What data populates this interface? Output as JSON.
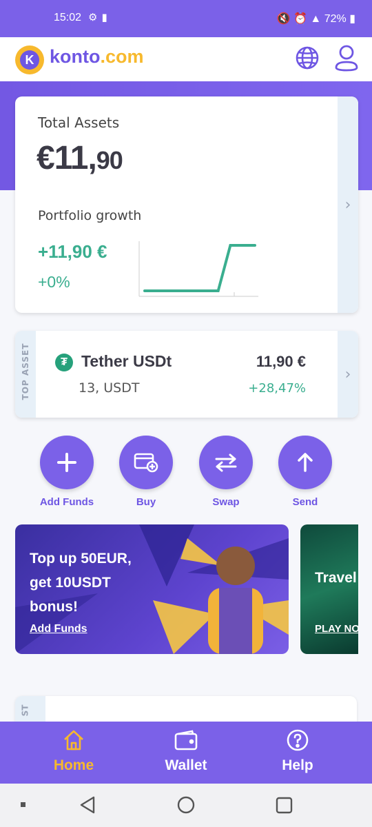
{
  "status_bar": {
    "time": "15:02",
    "battery": "72%"
  },
  "app": {
    "logo_letter": "K",
    "logo_name": "konto",
    "logo_tld": ".com"
  },
  "summary": {
    "total_assets_label": "Total Assets",
    "total_assets_main": "€11,",
    "total_assets_cents": "90",
    "portfolio_growth_label": "Portfolio growth",
    "growth_value": "+11,90 €",
    "growth_percent": "+0%"
  },
  "sparkline": {
    "values": [
      0,
      0,
      0,
      0,
      0,
      0,
      0,
      11.9,
      11.9,
      11.9
    ],
    "color": "#3aae8f"
  },
  "top_asset": {
    "side_label": "TOP ASSET",
    "icon_letter": "₮",
    "name": "Tether USDt",
    "amount": "13, USDT",
    "value": "11,90 €",
    "change": "+28,47%"
  },
  "actions": [
    {
      "label": "Add Funds",
      "icon": "plus-icon"
    },
    {
      "label": "Buy",
      "icon": "card-plus-icon"
    },
    {
      "label": "Swap",
      "icon": "swap-arrows-icon"
    },
    {
      "label": "Send",
      "icon": "arrow-up-icon"
    }
  ],
  "banners": [
    {
      "title": "Top up 50EUR, get 10USDT bonus!",
      "link": "Add Funds"
    },
    {
      "title": "Travel",
      "link": "PLAY NO"
    }
  ],
  "peek_card": {
    "side_label": "ST"
  },
  "bottom_nav": [
    {
      "label": "Home",
      "icon": "home-icon",
      "active": true
    },
    {
      "label": "Wallet",
      "icon": "wallet-icon",
      "active": false
    },
    {
      "label": "Help",
      "icon": "help-icon",
      "active": false
    }
  ],
  "colors": {
    "primary": "#7b61e8",
    "accent": "#f7b92d",
    "positive": "#3aae8f"
  }
}
